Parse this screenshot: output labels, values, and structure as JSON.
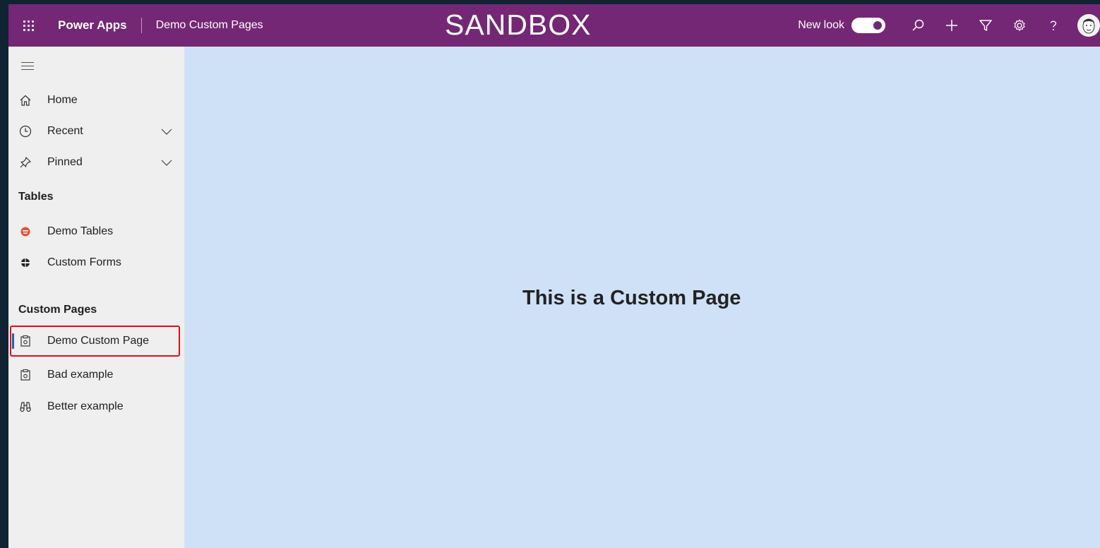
{
  "header": {
    "app_name": "Power Apps",
    "environment": "Demo Custom Pages",
    "banner": "SANDBOX",
    "new_look_label": "New look",
    "new_look_on": true,
    "background": "#742774"
  },
  "sidebar": {
    "top_items": [
      {
        "label": "Home",
        "icon": "home-icon"
      },
      {
        "label": "Recent",
        "icon": "clock-icon",
        "expandable": true
      },
      {
        "label": "Pinned",
        "icon": "pin-icon",
        "expandable": true
      }
    ],
    "groups": [
      {
        "title": "Tables",
        "items": [
          {
            "label": "Demo Tables",
            "icon": "emoji-icon"
          },
          {
            "label": "Custom Forms",
            "icon": "globe-icon"
          }
        ]
      },
      {
        "title": "Custom Pages",
        "items": [
          {
            "label": "Demo Custom Page",
            "icon": "custom-page-icon",
            "selected": true
          },
          {
            "label": "Bad example",
            "icon": "custom-page-icon"
          },
          {
            "label": "Better example",
            "icon": "binoculars-icon"
          }
        ]
      }
    ]
  },
  "main": {
    "heading": "This is a Custom Page",
    "background": "#cfe1f7"
  }
}
